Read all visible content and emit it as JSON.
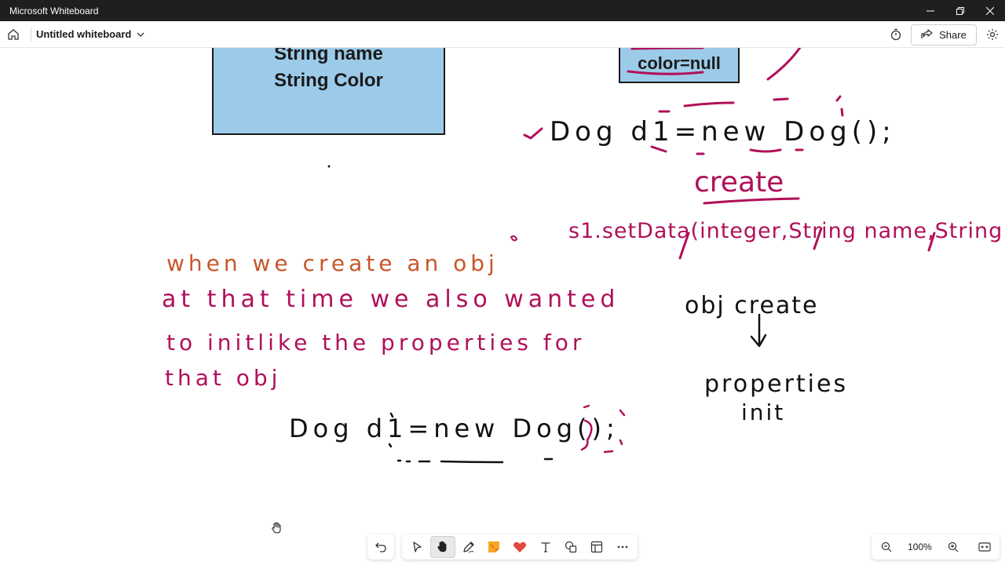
{
  "window": {
    "title": "Microsoft Whiteboard"
  },
  "header": {
    "board_title": "Untitled whiteboard",
    "share_label": "Share"
  },
  "canvas": {
    "card_left": {
      "lines": [
        "String name",
        "String Color"
      ],
      "fill_color": "#9ccbe9"
    },
    "card_right": {
      "lines": [
        "color=null"
      ],
      "fill_color": "#9ccbe9"
    },
    "ink": {
      "magenta_color": "#b0105a",
      "black_color": "#111111",
      "orange_color": "#c8562a",
      "note_top_right": "Dog d1=new Dog();",
      "note_create": "create",
      "note_setter": "s1.setData(integer,String name,String",
      "note_para_1": "when we create an obj",
      "note_para_2": "at that time we also wanted",
      "note_para_3": "to initlike the properties for",
      "note_para_4": "that obj",
      "note_dog_bottom": "Dog d1=new Dog();",
      "note_obj_create": "obj create",
      "note_properties": "properties",
      "note_init": "init"
    }
  },
  "toolbar": {
    "tools": [
      "undo",
      "select",
      "hand",
      "pen",
      "sticky-note",
      "reactions",
      "text",
      "shapes",
      "templates",
      "more"
    ],
    "active_tool": "hand"
  },
  "zoom": {
    "level": "100%"
  },
  "icons": {
    "minimize": "minimize-icon",
    "maximize": "maximize-icon",
    "close": "close-icon",
    "home": "home-icon",
    "chevron": "chevron-down-icon",
    "timer": "timer-icon",
    "share": "share-icon",
    "settings": "gear-icon"
  }
}
